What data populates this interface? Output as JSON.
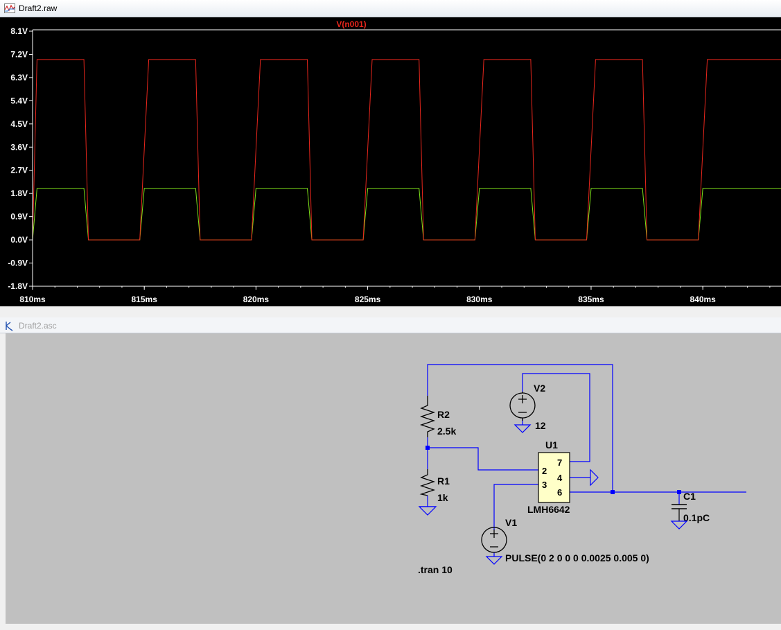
{
  "plot_window": {
    "title": "Draft2.raw",
    "trace_label": "V(n001)"
  },
  "schematic_window": {
    "title": "Draft2.asc"
  },
  "colors": {
    "plot_bg": "#000000",
    "trace_output": "#e8261c",
    "trace_input": "#7ee01a",
    "axis_text": "#ffffff",
    "schematic_bg": "#c0c0c0",
    "wire": "#0000ff",
    "component_fill": "#ffffc8"
  },
  "chart_data": {
    "type": "line",
    "title": "",
    "legend": [
      "V(n001)"
    ],
    "xlabel": "",
    "ylabel": "",
    "xlim": [
      810,
      843.5
    ],
    "ylim": [
      -1.8,
      8.1
    ],
    "x_ticks": [
      "810ms",
      "815ms",
      "820ms",
      "825ms",
      "830ms",
      "835ms",
      "840ms"
    ],
    "y_ticks": [
      "8.1V",
      "7.2V",
      "6.3V",
      "5.4V",
      "4.5V",
      "3.6V",
      "2.7V",
      "1.8V",
      "0.9V",
      "0.0V",
      "-0.9V",
      "-1.8V"
    ],
    "series": [
      {
        "name": "V(n001)",
        "color": "#e8261c",
        "x": [
          810.0,
          810.2,
          812.3,
          812.5,
          814.8,
          815.2,
          817.3,
          817.5,
          819.8,
          820.2,
          822.3,
          822.5,
          824.8,
          825.2,
          827.3,
          827.5,
          829.8,
          830.2,
          832.3,
          832.5,
          834.8,
          835.2,
          837.3,
          837.5,
          839.8,
          840.2,
          843.5
        ],
        "y": [
          0,
          7,
          7,
          0,
          0,
          7,
          7,
          0,
          0,
          7,
          7,
          0,
          0,
          7,
          7,
          0,
          0,
          7,
          7,
          0,
          0,
          7,
          7,
          0,
          0,
          7,
          7
        ]
      },
      {
        "x": [
          810.0,
          810.2,
          812.3,
          812.5,
          814.8,
          815.0,
          817.3,
          817.5,
          819.8,
          820.0,
          822.3,
          822.5,
          824.8,
          825.0,
          827.3,
          827.5,
          829.8,
          830.0,
          832.3,
          832.5,
          834.8,
          835.0,
          837.3,
          837.5,
          839.8,
          840.0,
          843.5
        ],
        "y": [
          0,
          2,
          2,
          0,
          0,
          2,
          2,
          0,
          0,
          2,
          2,
          0,
          0,
          2,
          2,
          0,
          0,
          2,
          2,
          0,
          0,
          2,
          2,
          0,
          0,
          2,
          2
        ],
        "color": "#7ee01a"
      }
    ]
  },
  "schematic": {
    "r2": {
      "name": "R2",
      "value": "2.5k"
    },
    "r1": {
      "name": "R1",
      "value": "1k"
    },
    "v2": {
      "name": "V2",
      "value": "12"
    },
    "v1": {
      "name": "V1",
      "value": "PULSE(0 2 0 0 0 0.0025 0.005 0)"
    },
    "u1": {
      "name": "U1",
      "part": "LMH6642",
      "pins": [
        "2",
        "3",
        "7",
        "4",
        "6"
      ]
    },
    "c1": {
      "name": "C1",
      "value": "0.1pC"
    },
    "directive": ".tran 10"
  }
}
